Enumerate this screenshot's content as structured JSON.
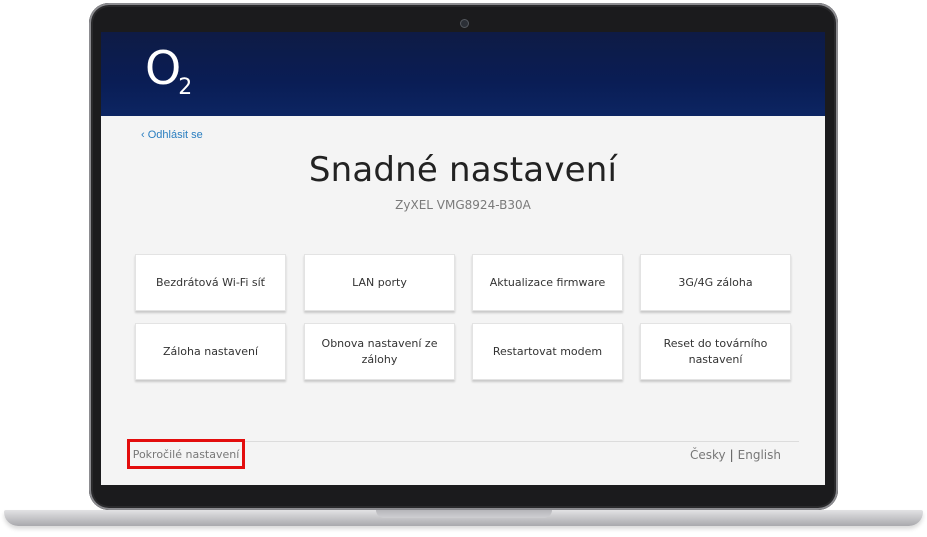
{
  "header": {
    "logo_main": "O",
    "logo_sub": "2"
  },
  "nav": {
    "logout": "‹ Odhlásit se"
  },
  "page": {
    "title": "Snadné nastavení",
    "subtitle": "ZyXEL VMG8924-B30A"
  },
  "tiles": [
    {
      "label": "Bezdrátová Wi-Fi síť"
    },
    {
      "label": "LAN porty"
    },
    {
      "label": "Aktualizace firmware"
    },
    {
      "label": "3G/4G záloha"
    },
    {
      "label": "Záloha nastavení"
    },
    {
      "label": "Obnova nastavení ze zálohy"
    },
    {
      "label": "Restartovat modem"
    },
    {
      "label": "Reset do továrního nastavení"
    }
  ],
  "footer": {
    "advanced": "Pokročilé nastavení",
    "lang_cs": "Česky",
    "lang_separator": "|",
    "lang_en": "English"
  },
  "colors": {
    "header_bg": "#0a1d55",
    "link": "#2a7ec0",
    "highlight": "#e30d0d"
  }
}
